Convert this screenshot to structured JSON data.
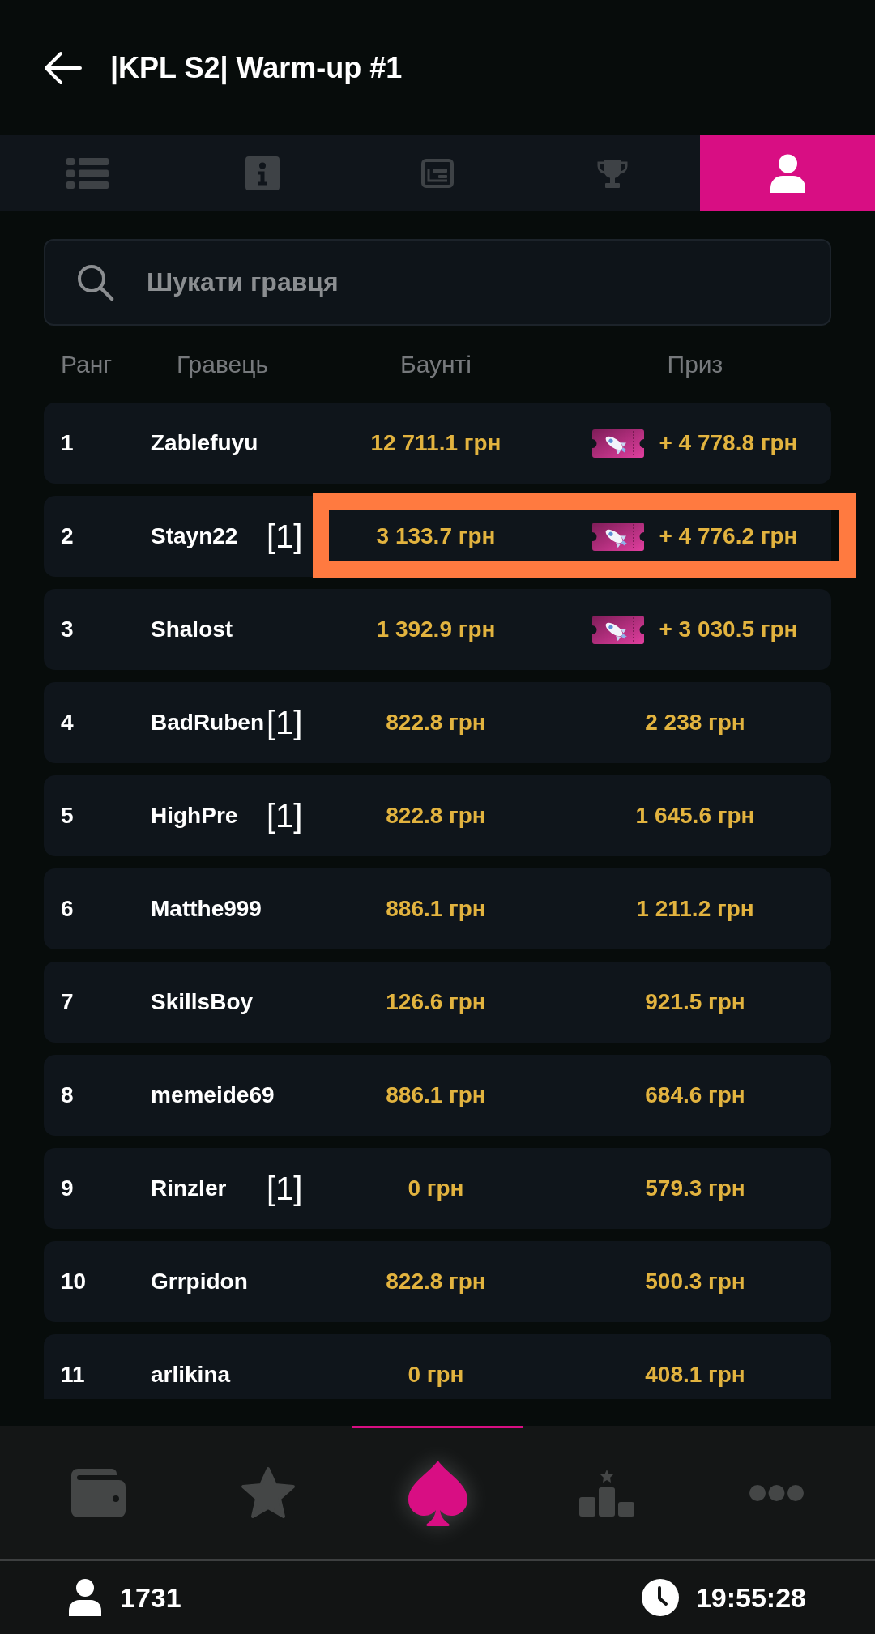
{
  "header": {
    "title": "|KPL S2| Warm-up #1"
  },
  "tabs": [
    {
      "kind": "list",
      "selected": false
    },
    {
      "kind": "info",
      "selected": false
    },
    {
      "kind": "news",
      "selected": false
    },
    {
      "kind": "trophy",
      "selected": false
    },
    {
      "kind": "player",
      "selected": true
    }
  ],
  "search": {
    "placeholder": "Шукати гравця"
  },
  "table": {
    "columns": [
      "Ранг",
      "Гравець",
      "Баунті",
      "Приз"
    ],
    "rows": [
      {
        "rank": "1",
        "player": "Zablefuyu",
        "bounty": "12 711.1 грн",
        "prize": "+ 4 778.8 грн",
        "ticket": true,
        "highlighted": false
      },
      {
        "rank": "2",
        "player": "Stayn22",
        "tag": "[1]",
        "bounty": "3 133.7 грн",
        "prize": "+ 4 776.2 грн",
        "ticket": true,
        "highlighted": true
      },
      {
        "rank": "3",
        "player": "Shalost",
        "bounty": "1 392.9 грн",
        "prize": "+ 3 030.5 грн",
        "ticket": true,
        "highlighted": false
      },
      {
        "rank": "4",
        "player": "BadRuben",
        "tag": "[1]",
        "bounty": "822.8 грн",
        "prize": "2 238 грн",
        "ticket": false,
        "highlighted": false
      },
      {
        "rank": "5",
        "player": "HighPre",
        "tag": "[1]",
        "bounty": "822.8 грн",
        "prize": "1 645.6 грн",
        "ticket": false,
        "highlighted": false
      },
      {
        "rank": "6",
        "player": "Matthe999",
        "bounty": "886.1 грн",
        "prize": "1 211.2 грн",
        "ticket": false,
        "highlighted": false
      },
      {
        "rank": "7",
        "player": "SkillsBoy",
        "bounty": "126.6 грн",
        "prize": "921.5 грн",
        "ticket": false,
        "highlighted": false
      },
      {
        "rank": "8",
        "player": "memeide69",
        "bounty": "886.1 грн",
        "prize": "684.6 грн",
        "ticket": false,
        "highlighted": false
      },
      {
        "rank": "9",
        "player": "Rinzler",
        "tag": "[1]",
        "bounty": "0 грн",
        "prize": "579.3 грн",
        "ticket": false,
        "highlighted": false
      },
      {
        "rank": "10",
        "player": "Grrpidon",
        "bounty": "822.8 грн",
        "prize": "500.3 грн",
        "ticket": false,
        "highlighted": false
      },
      {
        "rank": "11",
        "player": "arlikina",
        "bounty": "0 грн",
        "prize": "408.1 грн",
        "ticket": false,
        "highlighted": false
      }
    ]
  },
  "bottom_nav": [
    {
      "kind": "wallet",
      "selected": false
    },
    {
      "kind": "star",
      "selected": false
    },
    {
      "kind": "spade",
      "selected": true
    },
    {
      "kind": "podium",
      "selected": false
    },
    {
      "kind": "more",
      "selected": false
    }
  ],
  "status_bar": {
    "online": "1731",
    "time": "19:55:28"
  }
}
